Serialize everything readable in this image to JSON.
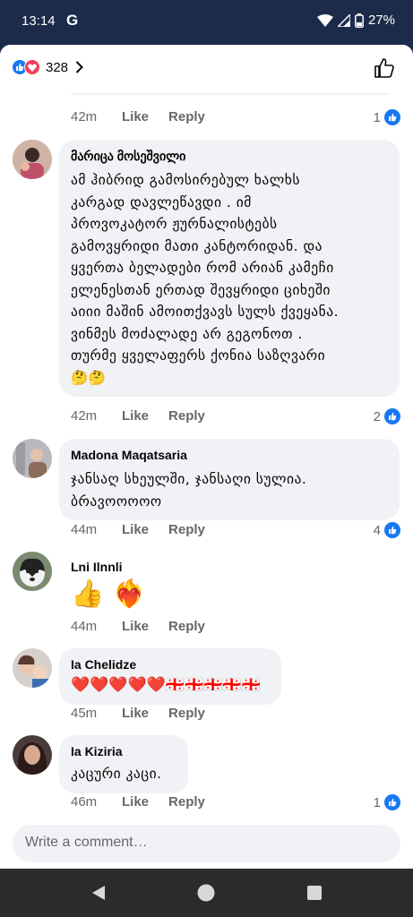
{
  "status": {
    "time": "13:14",
    "g": "G",
    "battery": "27%"
  },
  "header": {
    "reaction_count": "328"
  },
  "partial_comment": {
    "age": "42m",
    "like": "Like",
    "reply": "Reply",
    "likes": "1"
  },
  "comments": [
    {
      "author": "მარიცა მოსეშვილი",
      "lines": [
        "ამ ჰიბრიდ გამოსირებულ ხალხს",
        "კარგად დავლეწავდი . იმ",
        "პროვოკატორ ჟურნალისტებს",
        "გამოვყრიდი მათი კანტორიდან. და",
        "ყვერთა ბელადები რომ არიან კამეჩი",
        "ელენესთან ერთად შევყრიდი ციხეში",
        "აიიი მაშინ ამოითქვავს სულს ქვეყანა.",
        "ვინმეს მოძალადე არ გეგონოთ .",
        "თურმე ყველაფერს ქონია საზღვარი"
      ],
      "emoji": "🤔🤔",
      "age": "42m",
      "like": "Like",
      "reply": "Reply",
      "likes": "2"
    },
    {
      "author": "Madona Maqatsaria",
      "lines": [
        "ჯანსაღ სხეულში, ჯანსაღი სულია.",
        "ბრავოოოოო"
      ],
      "age": "44m",
      "like": "Like",
      "reply": "Reply",
      "likes": "4"
    },
    {
      "author": "Lni Ilnnli",
      "emoji": "👍 ❤️‍🔥",
      "age": "44m",
      "like": "Like",
      "reply": "Reply"
    },
    {
      "author": "Ia Chelidze",
      "emoji": "❤️❤️❤️❤️❤️🇬🇪🇬🇪🇬🇪🇬🇪🇬🇪",
      "age": "45m",
      "like": "Like",
      "reply": "Reply"
    },
    {
      "author": "Ia Kiziria",
      "lines": [
        "კაცური კაცი."
      ],
      "age": "46m",
      "like": "Like",
      "reply": "Reply",
      "likes": "1"
    }
  ],
  "composer": {
    "placeholder": "Write a comment…"
  },
  "colors": {
    "accent": "#1877f2",
    "love": "#f33e58",
    "bubble": "#f0f2f5",
    "statusbar": "#1c2b4a",
    "navbar": "#2b2b2b"
  }
}
